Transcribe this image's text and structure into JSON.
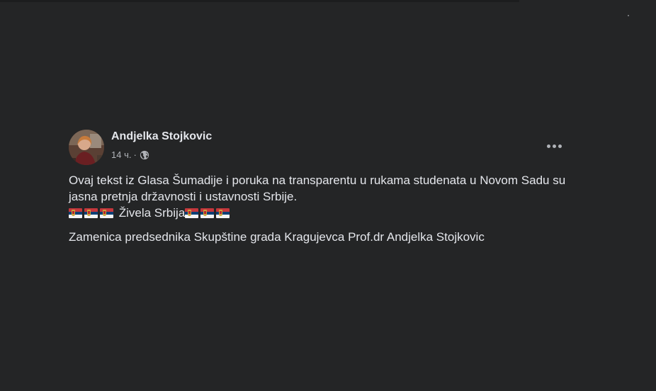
{
  "post": {
    "author_name": "Andjelka Stojkovic",
    "timestamp": "14 ч.",
    "separator": "·",
    "privacy_icon": "globe-icon",
    "more_icon": "more-options-icon",
    "text": {
      "paragraph1": "Ovaj tekst iz Glasa Šumadije i poruka na transparentu u rukama studenata u Novom Sadu su jasna pretnja državnosti i ustavnosti Srbije.",
      "slogan": "Živela Srbija",
      "flag_emoji": "serbia-flag-icon",
      "signature": "Zamenica predsednika Skupštine grada Kragujevca Prof.dr Andjelka Stojkovic"
    }
  },
  "colors": {
    "background": "#242526",
    "primary_text": "#e4e6eb",
    "secondary_text": "#b0b3b8"
  }
}
